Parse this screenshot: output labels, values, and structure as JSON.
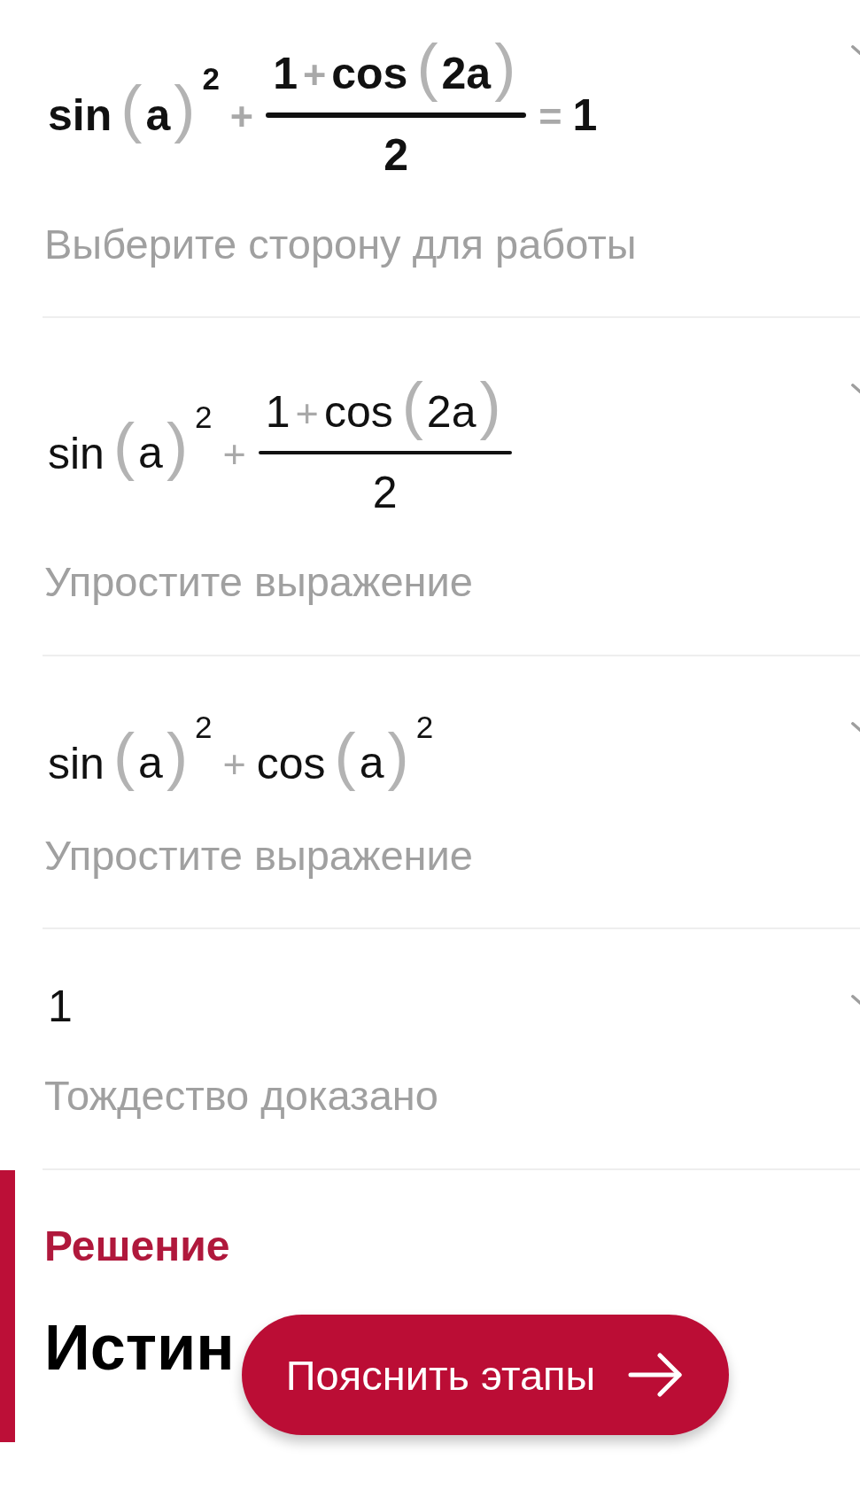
{
  "steps": [
    {
      "emphasized": true,
      "expression": [
        {
          "kind": "term",
          "text": "sin"
        },
        {
          "kind": "group",
          "open": "(",
          "close": ")",
          "body": [
            {
              "kind": "term",
              "text": "a"
            }
          ],
          "exponent": "2"
        },
        {
          "kind": "op",
          "text": "+"
        },
        {
          "kind": "fraction",
          "numerator": [
            {
              "kind": "term",
              "text": "1"
            },
            {
              "kind": "op",
              "text": "+"
            },
            {
              "kind": "term",
              "text": "cos"
            },
            {
              "kind": "group",
              "open": "(",
              "close": ")",
              "body": [
                {
                  "kind": "term",
                  "text": "2a"
                }
              ]
            }
          ],
          "denominator": [
            {
              "kind": "term",
              "text": "2"
            }
          ]
        },
        {
          "kind": "op",
          "text": "="
        },
        {
          "kind": "term",
          "text": "1"
        }
      ],
      "description": "Выберите сторону для работы"
    },
    {
      "emphasized": false,
      "expression": [
        {
          "kind": "term",
          "text": "sin"
        },
        {
          "kind": "group",
          "open": "(",
          "close": ")",
          "body": [
            {
              "kind": "term",
              "text": "a"
            }
          ],
          "exponent": "2"
        },
        {
          "kind": "op",
          "text": "+"
        },
        {
          "kind": "fraction",
          "numerator": [
            {
              "kind": "term",
              "text": "1"
            },
            {
              "kind": "op",
              "text": "+"
            },
            {
              "kind": "term",
              "text": "cos"
            },
            {
              "kind": "group",
              "open": "(",
              "close": ")",
              "body": [
                {
                  "kind": "term",
                  "text": "2a"
                }
              ]
            }
          ],
          "denominator": [
            {
              "kind": "term",
              "text": "2"
            }
          ]
        }
      ],
      "description": "Упростите выражение"
    },
    {
      "emphasized": false,
      "expression": [
        {
          "kind": "term",
          "text": "sin"
        },
        {
          "kind": "group",
          "open": "(",
          "close": ")",
          "body": [
            {
              "kind": "term",
              "text": "a"
            }
          ],
          "exponent": "2"
        },
        {
          "kind": "op",
          "text": "+"
        },
        {
          "kind": "term",
          "text": "cos"
        },
        {
          "kind": "group",
          "open": "(",
          "close": ")",
          "body": [
            {
              "kind": "term",
              "text": "a"
            }
          ],
          "exponent": "2"
        }
      ],
      "description": "Упростите выражение"
    },
    {
      "emphasized": false,
      "expression": [
        {
          "kind": "term",
          "text": "1"
        }
      ],
      "description": "Тождество доказано"
    }
  ],
  "solution": {
    "heading": "Решение",
    "answer": "Истин"
  },
  "explain_button": {
    "label": "Пояснить этапы"
  }
}
